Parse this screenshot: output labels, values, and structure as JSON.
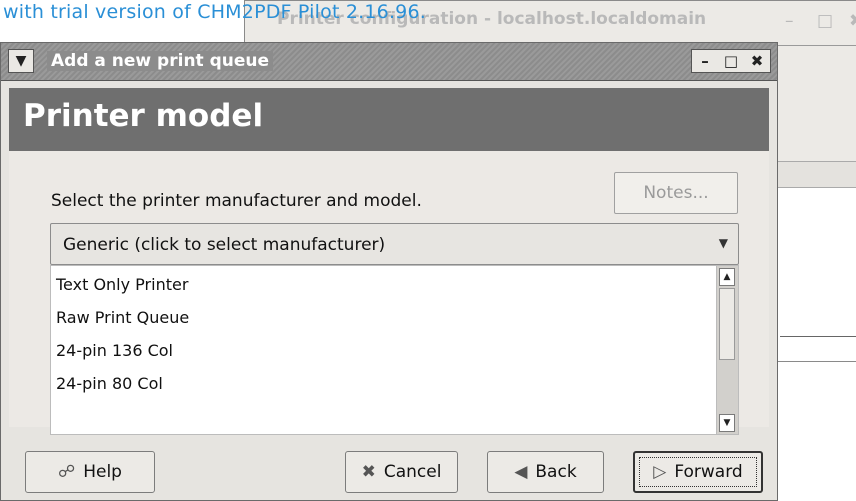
{
  "watermark": "with trial version of CHM2PDF Pilot 2.16.96.",
  "background_window": {
    "title": "Printer configuration - localhost.localdomain",
    "minimize_icon": "minimize-icon",
    "maximize_icon": "maximize-icon",
    "close_icon": "close-icon"
  },
  "dialog": {
    "title": "Add a new print queue",
    "header": "Printer model",
    "prompt": "Select the printer manufacturer and model.",
    "notes_label": "Notes...",
    "manufacturer_value": "Generic (click to select manufacturer)",
    "models": [
      "Text Only Printer",
      "Raw Print Queue",
      "24-pin 136 Col",
      "24-pin 80 Col"
    ],
    "buttons": {
      "help": "Help",
      "cancel": "Cancel",
      "back": "Back",
      "forward": "Forward"
    }
  },
  "colors": {
    "header_bg": "#6f6f6f",
    "dialog_bg": "#e6e4e0",
    "watermark": "#2a8fd6"
  }
}
